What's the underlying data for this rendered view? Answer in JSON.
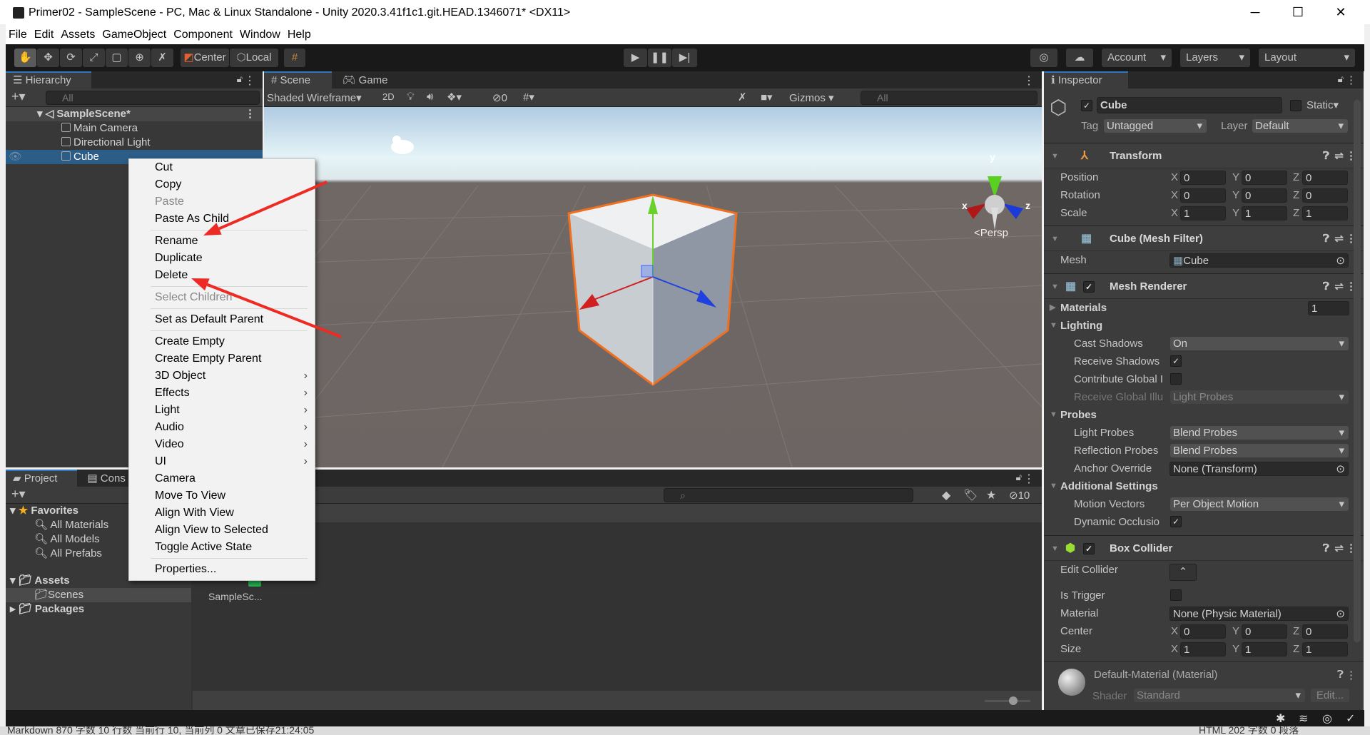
{
  "window": {
    "title": "Primer02 - SampleScene - PC, Mac & Linux Standalone - Unity 2020.3.41f1c1.git.HEAD.1346071* <DX11>",
    "minimize": "─",
    "maximize": "☐",
    "close": "✕"
  },
  "menubar": [
    "File",
    "Edit",
    "Assets",
    "GameObject",
    "Component",
    "Window",
    "Help"
  ],
  "toolbar": {
    "pivot": "Center",
    "space": "Local",
    "account": "Account",
    "layers": "Layers",
    "layout": "Layout"
  },
  "hierarchy": {
    "tab": "Hierarchy",
    "search_placeholder": "All",
    "scene": "SampleScene*",
    "items": [
      "Main Camera",
      "Directional Light",
      "Cube"
    ],
    "selected": "Cube"
  },
  "scene": {
    "tabs": [
      "Scene",
      "Game"
    ],
    "draw_mode": "Shaded Wireframe",
    "mode_2d": "2D",
    "hidden_count": "0",
    "gizmos": "Gizmos",
    "search_placeholder": "All",
    "persp": "Persp",
    "axes": {
      "x": "x",
      "y": "y",
      "z": "z"
    }
  },
  "context_menu": [
    {
      "label": "Cut"
    },
    {
      "label": "Copy"
    },
    {
      "label": "Paste",
      "disabled": true
    },
    {
      "label": "Paste As Child"
    },
    {
      "sep": true
    },
    {
      "label": "Rename"
    },
    {
      "label": "Duplicate"
    },
    {
      "label": "Delete"
    },
    {
      "sep": true
    },
    {
      "label": "Select Children",
      "disabled": true
    },
    {
      "sep": true
    },
    {
      "label": "Set as Default Parent"
    },
    {
      "sep": true
    },
    {
      "label": "Create Empty"
    },
    {
      "label": "Create Empty Parent"
    },
    {
      "label": "3D Object",
      "submenu": true
    },
    {
      "label": "Effects",
      "submenu": true
    },
    {
      "label": "Light",
      "submenu": true
    },
    {
      "label": "Audio",
      "submenu": true
    },
    {
      "label": "Video",
      "submenu": true
    },
    {
      "label": "UI",
      "submenu": true
    },
    {
      "label": "Camera"
    },
    {
      "label": "Move To View"
    },
    {
      "label": "Align With View"
    },
    {
      "label": "Align View to Selected"
    },
    {
      "label": "Toggle Active State"
    },
    {
      "sep": true
    },
    {
      "label": "Properties..."
    }
  ],
  "annotation_color": "#ee2a24",
  "project": {
    "tabs": [
      "Project",
      "Cons"
    ],
    "favorites": "Favorites",
    "favorite_items": [
      "All Materials",
      "All Models",
      "All Prefabs"
    ],
    "assets": "Assets",
    "scenes": "Scenes",
    "packages": "Packages",
    "asset_file": "SampleSc...",
    "hidden_count": "10",
    "zoom_slider": 0.6
  },
  "inspector": {
    "tab": "Inspector",
    "name": "Cube",
    "active": true,
    "static": "Static",
    "tag_label": "Tag",
    "tag": "Untagged",
    "layer_label": "Layer",
    "layer": "Default",
    "transform": {
      "title": "Transform",
      "rows": [
        {
          "label": "Position",
          "x": "0",
          "y": "0",
          "z": "0"
        },
        {
          "label": "Rotation",
          "x": "0",
          "y": "0",
          "z": "0"
        },
        {
          "label": "Scale",
          "x": "1",
          "y": "1",
          "z": "1"
        }
      ]
    },
    "mesh_filter": {
      "title": "Cube (Mesh Filter)",
      "mesh_label": "Mesh",
      "mesh": "Cube"
    },
    "mesh_renderer": {
      "title": "Mesh Renderer",
      "materials": "Materials",
      "materials_count": "1",
      "lighting": "Lighting",
      "cast_shadows": "Cast Shadows",
      "cast_shadows_value": "On",
      "receive_shadows": "Receive Shadows",
      "contribute_gi": "Contribute Global I",
      "receive_gi": "Receive Global Illu",
      "receive_gi_value": "Light Probes",
      "probes": "Probes",
      "light_probes": "Light Probes",
      "light_probes_value": "Blend Probes",
      "reflection_probes": "Reflection Probes",
      "reflection_probes_value": "Blend Probes",
      "anchor_override": "Anchor Override",
      "anchor_override_value": "None (Transform)",
      "additional": "Additional Settings",
      "motion_vectors": "Motion Vectors",
      "motion_vectors_value": "Per Object Motion",
      "dynamic_occlusion": "Dynamic Occlusio"
    },
    "box_collider": {
      "title": "Box Collider",
      "edit_collider": "Edit Collider",
      "is_trigger": "Is Trigger",
      "material": "Material",
      "material_value": "None (Physic Material)",
      "center": {
        "label": "Center",
        "x": "0",
        "y": "0",
        "z": "0"
      },
      "size": {
        "label": "Size",
        "x": "1",
        "y": "1",
        "z": "1"
      }
    },
    "material": {
      "title": "Default-Material (Material)",
      "shader_label": "Shader",
      "shader": "Standard",
      "edit": "Edit..."
    }
  },
  "background_status": {
    "left": "Markdown 870 字数 10 行数 当前行 10, 当前列 0 文章已保存21:24:05",
    "right": "HTML 202 字数 0 段落"
  }
}
